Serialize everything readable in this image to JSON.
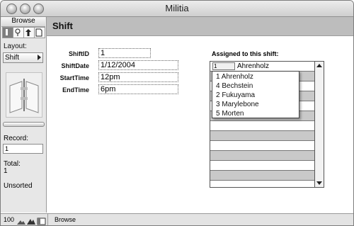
{
  "window": {
    "title": "Militia"
  },
  "sidebar": {
    "mode": "Browse",
    "layout_label": "Layout:",
    "layout_value": "Shift",
    "record_label": "Record:",
    "record_value": "1",
    "total_label": "Total:",
    "total_value": "1",
    "sort_status": "Unsorted"
  },
  "header": {
    "title": "Shift"
  },
  "fields": {
    "shift_id": {
      "label": "ShiftID",
      "value": "1"
    },
    "shift_date": {
      "label": "ShiftDate",
      "value": "1/12/2004"
    },
    "start_time": {
      "label": "StartTime",
      "value": "12pm"
    },
    "end_time": {
      "label": "EndTime",
      "value": "6pm"
    }
  },
  "portal": {
    "label": "Assigned to this shift:",
    "first_row": {
      "id": "1",
      "name": "Ahrenholz"
    },
    "dropdown": [
      "1 Ahrenholz",
      "4 Bechstein",
      "2 Fukuyama",
      "3 Marylebone",
      "5 Morten"
    ]
  },
  "status": {
    "zoom": "100",
    "mode": "Browse"
  }
}
